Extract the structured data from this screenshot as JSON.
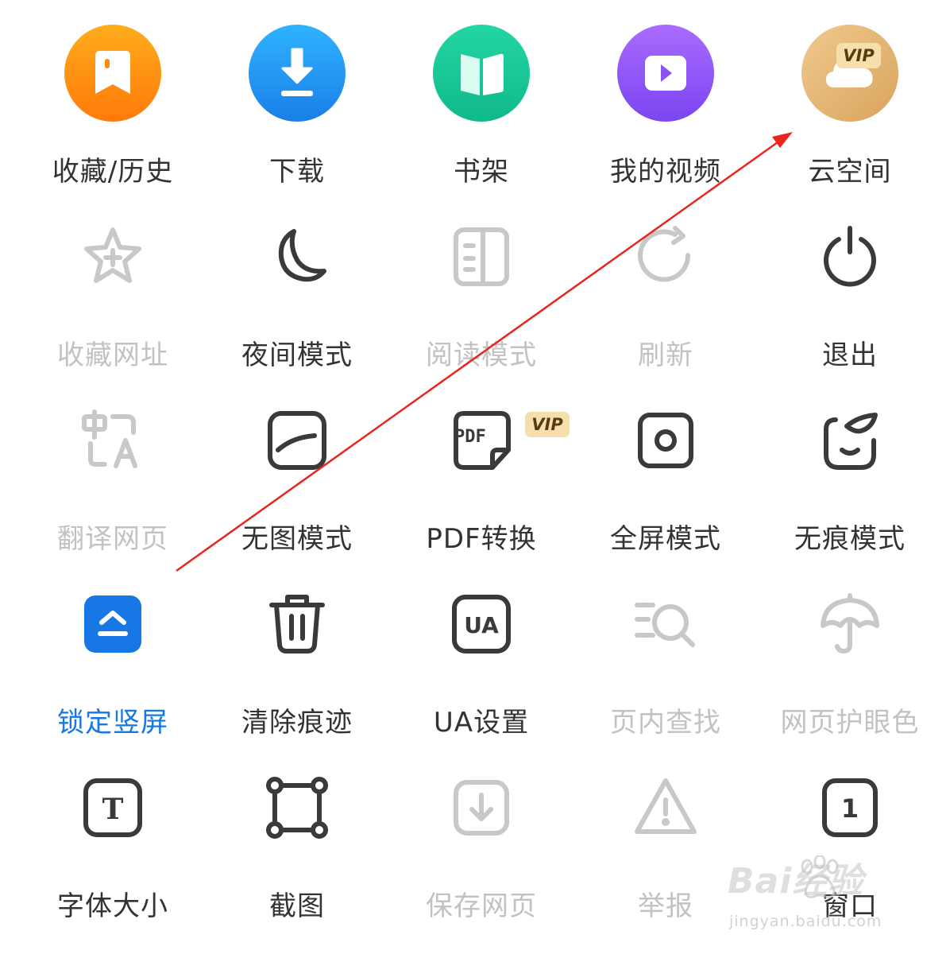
{
  "vip_badge": "VIP",
  "colors": {
    "active": "#333333",
    "disabled": "#c2c2c2",
    "highlight": "#1677e5",
    "annotation_arrow": "#e8261f"
  },
  "menu": {
    "rows": [
      [
        {
          "label": "收藏/历史",
          "icon": "bookmark-icon",
          "state": "active"
        },
        {
          "label": "下载",
          "icon": "download-icon",
          "state": "active"
        },
        {
          "label": "书架",
          "icon": "book-icon",
          "state": "active"
        },
        {
          "label": "我的视频",
          "icon": "video-play-icon",
          "state": "active"
        },
        {
          "label": "云空间",
          "icon": "cloud-icon",
          "state": "active",
          "vip": true
        }
      ],
      [
        {
          "label": "收藏网址",
          "icon": "star-plus-icon",
          "state": "disabled"
        },
        {
          "label": "夜间模式",
          "icon": "moon-icon",
          "state": "active"
        },
        {
          "label": "阅读模式",
          "icon": "reader-icon",
          "state": "disabled"
        },
        {
          "label": "刷新",
          "icon": "refresh-icon",
          "state": "disabled"
        },
        {
          "label": "退出",
          "icon": "power-icon",
          "state": "active"
        }
      ],
      [
        {
          "label": "翻译网页",
          "icon": "translate-icon",
          "state": "disabled"
        },
        {
          "label": "无图模式",
          "icon": "no-image-icon",
          "state": "active"
        },
        {
          "label": "PDF转换",
          "icon": "pdf-icon",
          "state": "active",
          "vip": true
        },
        {
          "label": "全屏模式",
          "icon": "fullscreen-icon",
          "state": "active"
        },
        {
          "label": "无痕模式",
          "icon": "incognito-icon",
          "state": "active"
        }
      ],
      [
        {
          "label": "锁定竖屏",
          "icon": "lock-portrait-icon",
          "state": "highlighted"
        },
        {
          "label": "清除痕迹",
          "icon": "trash-icon",
          "state": "active"
        },
        {
          "label": "UA设置",
          "icon": "ua-icon",
          "state": "active"
        },
        {
          "label": "页内查找",
          "icon": "find-in-page-icon",
          "state": "disabled"
        },
        {
          "label": "网页护眼色",
          "icon": "umbrella-icon",
          "state": "disabled"
        }
      ],
      [
        {
          "label": "字体大小",
          "icon": "font-size-icon",
          "state": "active"
        },
        {
          "label": "截图",
          "icon": "screenshot-icon",
          "state": "active"
        },
        {
          "label": "保存网页",
          "icon": "save-page-icon",
          "state": "disabled"
        },
        {
          "label": "举报",
          "icon": "warning-icon",
          "state": "disabled"
        },
        {
          "label": "窗口",
          "icon": "window-count-icon",
          "state": "active",
          "icon_text": "1"
        }
      ]
    ]
  },
  "icon_text": {
    "pdf": "PDF",
    "ua": "UA",
    "font": "T",
    "window": "1"
  },
  "watermark": {
    "main": "Bai经验",
    "sub": "jingyan.baidu.com"
  }
}
